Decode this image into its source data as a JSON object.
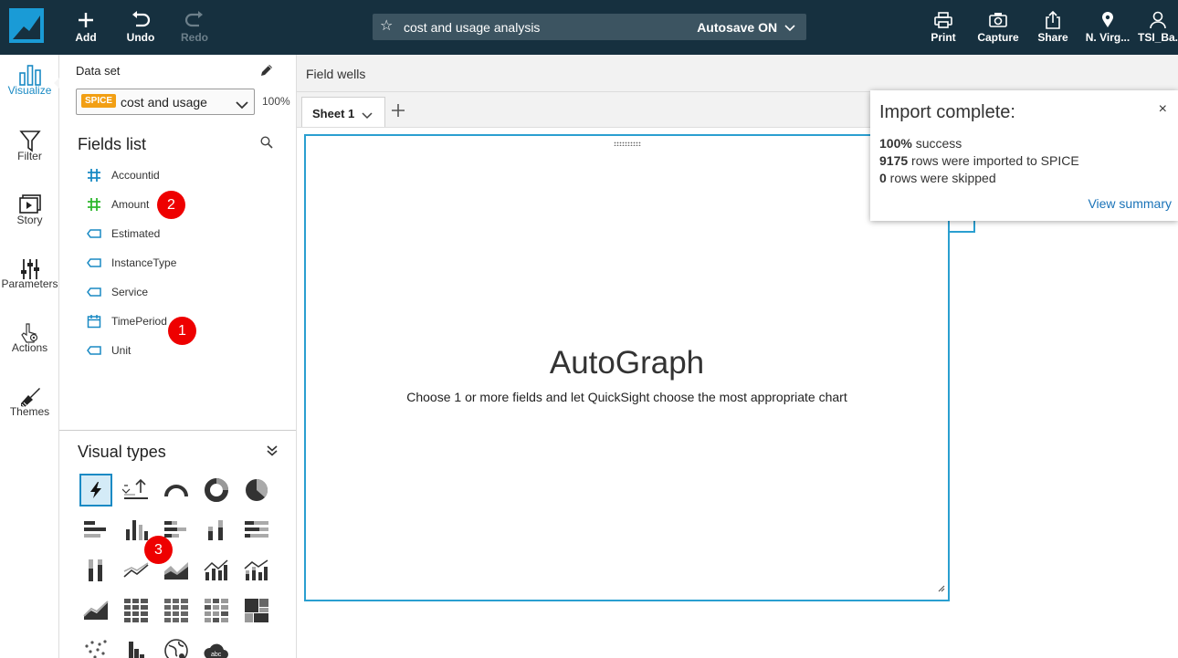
{
  "topbar": {
    "add": "Add",
    "undo": "Undo",
    "redo": "Redo",
    "analysis_title": "cost and usage analysis",
    "autosave": "Autosave ON",
    "print": "Print",
    "capture": "Capture",
    "share": "Share",
    "region": "N. Virg...",
    "user": "TSI_Ba..."
  },
  "rail": {
    "items": [
      {
        "label": "Visualize",
        "icon": "bar-chart-icon"
      },
      {
        "label": "Filter",
        "icon": "funnel-icon"
      },
      {
        "label": "Story",
        "icon": "story-icon"
      },
      {
        "label": "Parameters",
        "icon": "sliders-icon"
      },
      {
        "label": "Actions",
        "icon": "pointer-gear-icon"
      },
      {
        "label": "Themes",
        "icon": "brush-icon"
      }
    ],
    "active_color": "#1a8ac4"
  },
  "dataset": {
    "label": "Data set",
    "badge": "SPICE",
    "name": "cost and usage",
    "percent": "100%"
  },
  "fields_list": {
    "title": "Fields list",
    "fields": [
      {
        "name": "Accountid",
        "type": "numeric"
      },
      {
        "name": "Amount",
        "type": "measure"
      },
      {
        "name": "Estimated",
        "type": "string"
      },
      {
        "name": "InstanceType",
        "type": "string"
      },
      {
        "name": "Service",
        "type": "string"
      },
      {
        "name": "TimePeriod",
        "type": "date"
      },
      {
        "name": "Unit",
        "type": "string"
      }
    ]
  },
  "visual_types": {
    "title": "Visual types",
    "icons": [
      "autograph-icon",
      "kpi-icon",
      "gauge-icon",
      "donut-icon",
      "pie-icon",
      "horizontal-bar-icon",
      "vertical-bar-icon",
      "stacked-horizontal-bar-icon",
      "stacked-vertical-bar-icon",
      "percent-horizontal-bar-icon",
      "percent-vertical-bar-icon",
      "line-icon",
      "area-icon",
      "combo-bar-line-icon",
      "combo-stacked-line-icon",
      "stacked-area-icon",
      "pivot-table-icon",
      "table-icon",
      "heat-map-icon",
      "tree-map-icon",
      "scatter-icon",
      "histogram-icon",
      "geo-map-icon",
      "word-cloud-icon"
    ]
  },
  "field_wells": "Field wells",
  "sheet": {
    "tab": "Sheet 1"
  },
  "visual": {
    "title": "AutoGraph",
    "subtitle": "Choose 1 or more fields and let QuickSight choose the most appropriate chart"
  },
  "toast": {
    "title": "Import complete:",
    "line1_bold": "100%",
    "line1_rest": " success",
    "line2_bold": "9175",
    "line2_rest": " rows were imported to SPICE",
    "line3_bold": "0",
    "line3_rest": " rows were skipped",
    "link": "View summary",
    "close": "×"
  },
  "markers": [
    "1",
    "2",
    "3"
  ],
  "colors": {
    "topbar": "#16303f",
    "accent": "#1a8ac4",
    "spice_badge": "#f29f13",
    "marker": "#e00000"
  }
}
